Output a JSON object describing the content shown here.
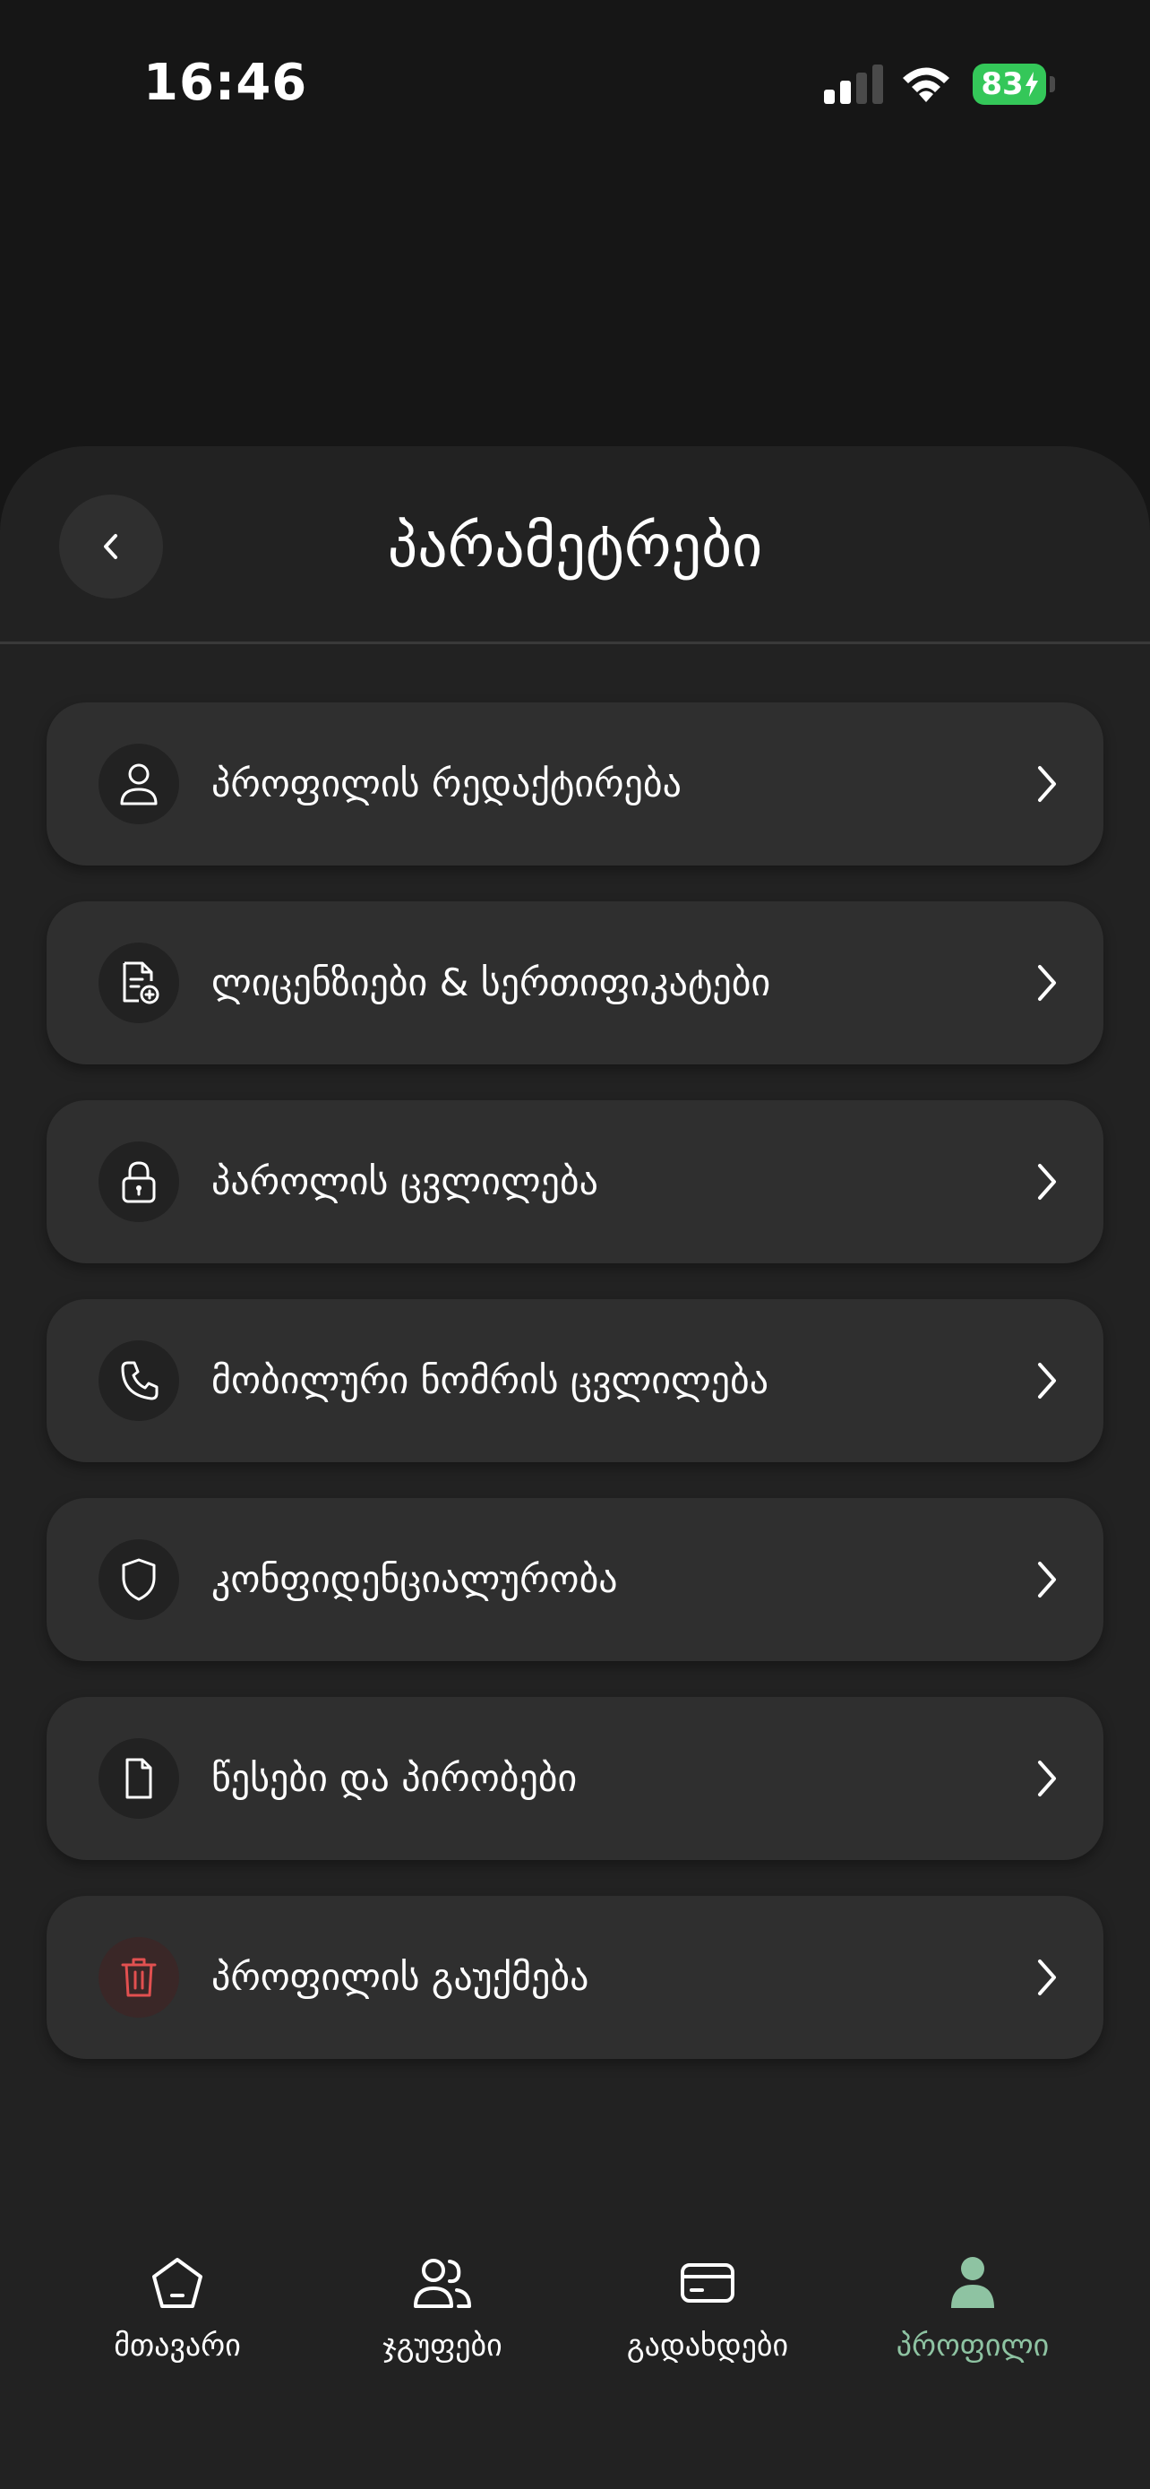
{
  "status_bar": {
    "time": "16:46",
    "battery": "83"
  },
  "header": {
    "title": "პარამეტრები",
    "back_icon": "chevron-left-icon"
  },
  "menu": [
    {
      "label": "პროფილის რედაქტირება",
      "icon": "user-icon"
    },
    {
      "label": "ლიცენზიები & სერთიფიკატები",
      "icon": "document-badge-icon"
    },
    {
      "label": "პაროლის ცვლილება",
      "icon": "lock-icon"
    },
    {
      "label": "მობილური ნომრის ცვლილება",
      "icon": "phone-icon"
    },
    {
      "label": "კონფიდენციალურობა",
      "icon": "shield-icon"
    },
    {
      "label": "წესები და პირობები",
      "icon": "file-icon"
    },
    {
      "label": "პროფილის გაუქმება",
      "icon": "trash-icon"
    }
  ],
  "tabs": [
    {
      "label": "მთავარი",
      "icon": "home-icon",
      "active": false
    },
    {
      "label": "ჯგუფები",
      "icon": "users-icon",
      "active": false
    },
    {
      "label": "გადახდები",
      "icon": "card-icon",
      "active": false
    },
    {
      "label": "პროფილი",
      "icon": "profile-icon",
      "active": true
    }
  ],
  "colors": {
    "background": "#161616",
    "sheet": "#222222",
    "card": "#2f2f2f",
    "accent": "#8ec3a2",
    "danger": "#e25050",
    "battery": "#34c759"
  }
}
